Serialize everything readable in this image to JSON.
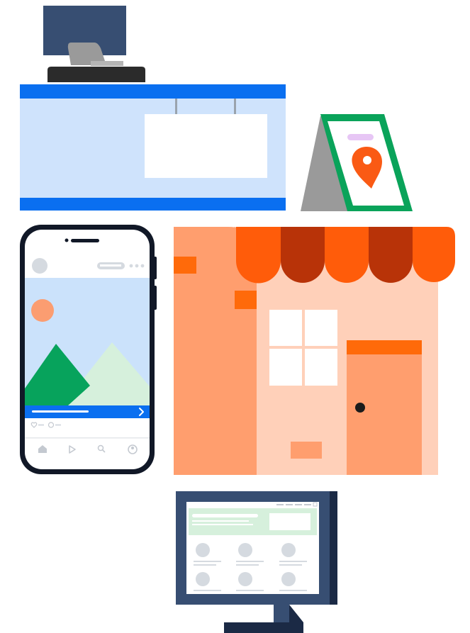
{
  "scene": {
    "elements": [
      "checkout-counter-with-monitor",
      "sandwich-board-location-sign",
      "smartphone-social-feed",
      "storefront-with-awning",
      "desktop-monitor-webpage"
    ]
  },
  "colors": {
    "counter_blue": "#0a6ff0",
    "counter_light": "#cfe3fc",
    "monitor_navy": "#374e72",
    "monitor_dark": "#1b2a45",
    "sign_green": "#0aa35a",
    "pin_orange": "#fa5a14",
    "awning_orange": "#ff5c0a",
    "awning_dark": "#b83308",
    "store_peach": "#ffd0b9",
    "store_salmon": "#ff9e6e",
    "store_accent": "#ff6a0a",
    "phone_black": "#111827",
    "feed_blue": "#cbe2fb",
    "mountain_green": "#07a35c",
    "mountain_mint": "#d6f0dc",
    "sun_salmon": "#fb9d71",
    "cta_blue": "#0a6ff0"
  },
  "phone": {
    "nav_icons": [
      "home-icon",
      "play-icon",
      "search-icon",
      "profile-icon"
    ],
    "reaction_icons": [
      "heart-icon",
      "comment-icon"
    ],
    "cta_icon": "chevron-right-icon",
    "menu_icon": "more-dots-icon"
  },
  "sign": {
    "icon": "location-pin-icon"
  },
  "desktop": {
    "product_tiles": 6
  }
}
